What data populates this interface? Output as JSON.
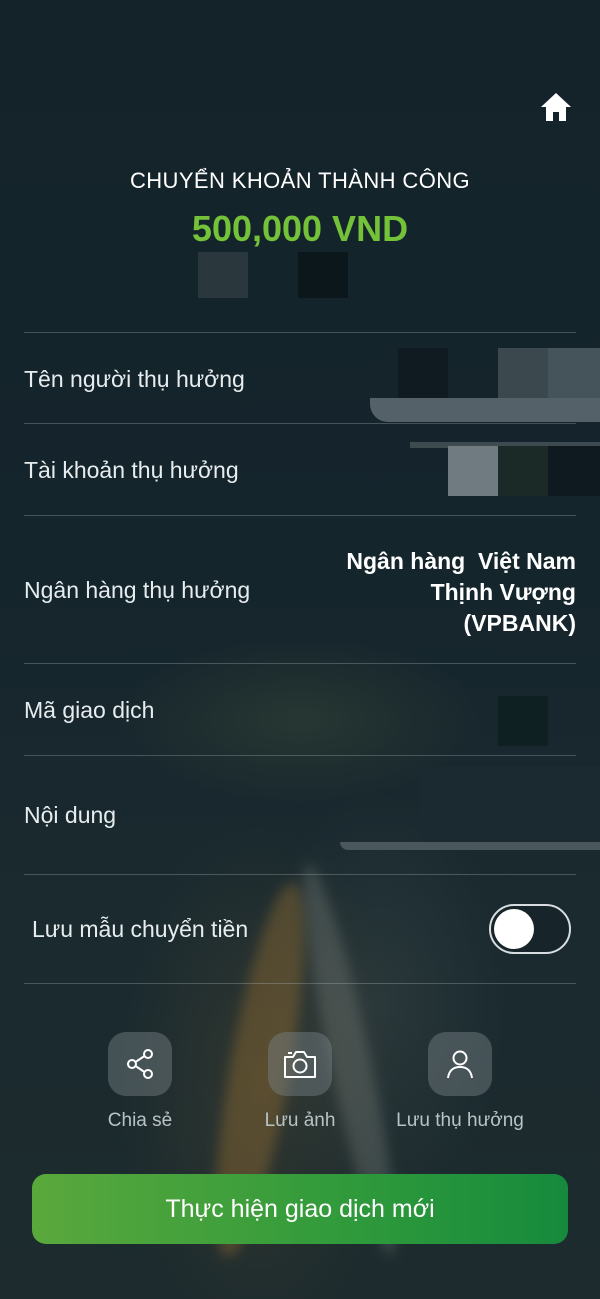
{
  "header": {
    "title": "CHUYỂN KHOẢN THÀNH CÔNG",
    "amount": "500,000 VND"
  },
  "details": {
    "beneficiary_name_label": "Tên người thụ hưởng",
    "beneficiary_account_label": "Tài khoản thụ hưởng",
    "beneficiary_bank_label": "Ngân hàng thụ hưởng",
    "beneficiary_bank_value_lines": [
      "Ngân hàng  Việt Nam",
      "Thịnh Vượng",
      "(VPBANK)"
    ],
    "transaction_code_label": "Mã giao dịch",
    "content_label": "Nội dung"
  },
  "save_template": {
    "label": "Lưu mẫu chuyển tiền",
    "enabled": false
  },
  "actions": [
    {
      "label": "Chia sẻ",
      "icon": "share-icon"
    },
    {
      "label": "Lưu ảnh",
      "icon": "camera-icon"
    },
    {
      "label": "Lưu thụ hưởng",
      "icon": "user-icon"
    }
  ],
  "cta": {
    "label": "Thực hiện giao dịch mới"
  },
  "colors": {
    "background": "#132128",
    "amount_green": "#74c23a",
    "button_green_start": "#5aa83c",
    "button_green_end": "#168a3c"
  }
}
